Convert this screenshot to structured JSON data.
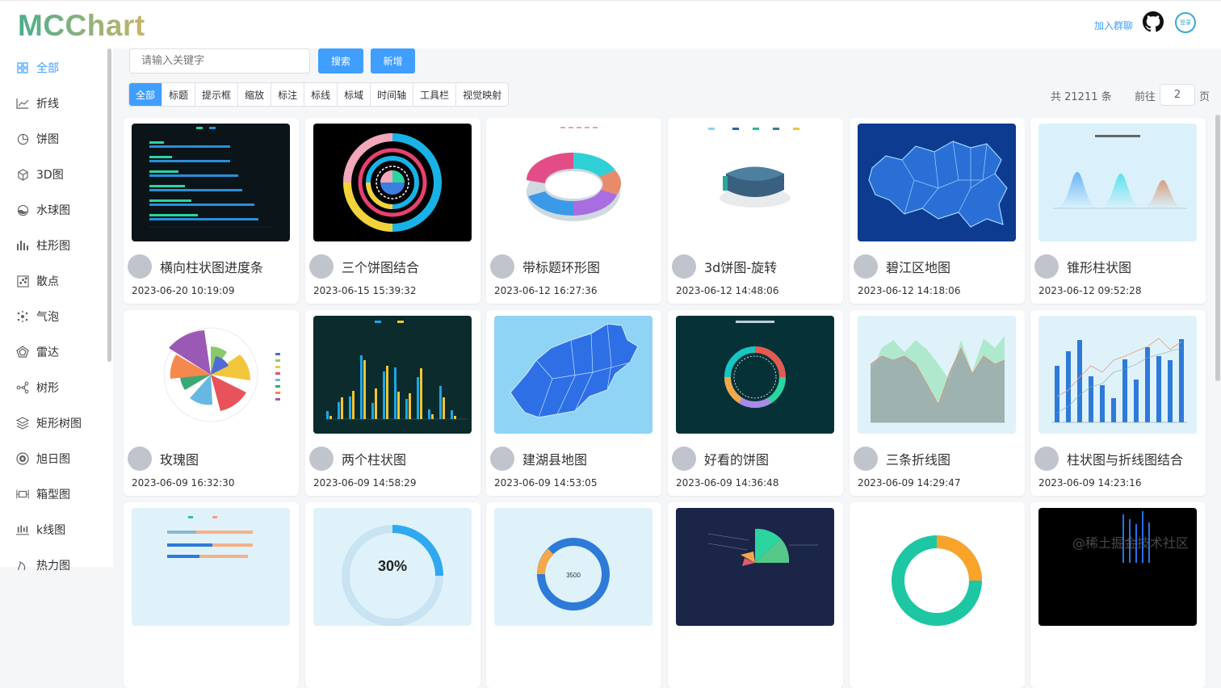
{
  "app": {
    "logo": "MCChart",
    "join_group": "加入群聊",
    "user_avatar_text": "登录"
  },
  "sidebar": {
    "items": [
      {
        "label": "全部",
        "icon": "grid-icon",
        "active": true
      },
      {
        "label": "折线",
        "icon": "line-chart-icon"
      },
      {
        "label": "饼图",
        "icon": "pie-chart-icon"
      },
      {
        "label": "3D图",
        "icon": "cube-icon"
      },
      {
        "label": "水球图",
        "icon": "liquid-ball-icon"
      },
      {
        "label": "柱形图",
        "icon": "bar-chart-icon"
      },
      {
        "label": "散点",
        "icon": "scatter-icon"
      },
      {
        "label": "气泡",
        "icon": "bubble-icon"
      },
      {
        "label": "雷达",
        "icon": "radar-icon"
      },
      {
        "label": "树形",
        "icon": "tree-icon"
      },
      {
        "label": "矩形树图",
        "icon": "treemap-icon"
      },
      {
        "label": "旭日图",
        "icon": "sunburst-icon"
      },
      {
        "label": "箱型图",
        "icon": "boxplot-icon"
      },
      {
        "label": "k线图",
        "icon": "candlestick-icon"
      },
      {
        "label": "热力图",
        "icon": "heatmap-icon"
      }
    ]
  },
  "search": {
    "placeholder": "请输入关键字",
    "search_label": "搜索",
    "add_label": "新增"
  },
  "filters": [
    "全部",
    "标题",
    "提示框",
    "缩放",
    "标注",
    "标线",
    "标域",
    "时间轴",
    "工具栏",
    "视觉映射"
  ],
  "pagination": {
    "total_text": "共 21211 条",
    "goto_prefix": "前往",
    "page": "2",
    "goto_suffix": "页"
  },
  "cards": [
    {
      "title": "横向柱状图进度条",
      "date": "2023-06-20 10:19:09",
      "thumb": "hbar-progress"
    },
    {
      "title": "三个饼图结合",
      "date": "2023-06-15 15:39:32",
      "thumb": "triple-pie"
    },
    {
      "title": "带标题环形图",
      "date": "2023-06-12 16:27:36",
      "thumb": "ring-3d"
    },
    {
      "title": "3d饼图-旋转",
      "date": "2023-06-12 14:48:06",
      "thumb": "pie-3d-rotate"
    },
    {
      "title": "碧江区地图",
      "date": "2023-06-12 14:18:06",
      "thumb": "map-blue"
    },
    {
      "title": "锥形柱状图",
      "date": "2023-06-12 09:52:28",
      "thumb": "cone-bar"
    },
    {
      "title": "玫瑰图",
      "date": "2023-06-09 16:32:30",
      "thumb": "rose"
    },
    {
      "title": "两个柱状图",
      "date": "2023-06-09 14:58:29",
      "thumb": "double-bar"
    },
    {
      "title": "建湖县地图",
      "date": "2023-06-09 14:53:05",
      "thumb": "map-light"
    },
    {
      "title": "好看的饼图",
      "date": "2023-06-09 14:36:48",
      "thumb": "nice-pie"
    },
    {
      "title": "三条折线图",
      "date": "2023-06-09 14:29:47",
      "thumb": "three-lines"
    },
    {
      "title": "柱状图与折线图结合",
      "date": "2023-06-09 14:23:16",
      "thumb": "bar-line"
    },
    {
      "title": "",
      "date": "",
      "thumb": "hbar-light"
    },
    {
      "title": "",
      "date": "",
      "thumb": "gauge-30"
    },
    {
      "title": "",
      "date": "",
      "thumb": "ring-3500"
    },
    {
      "title": "",
      "date": "",
      "thumb": "dark-funnel-pie"
    },
    {
      "title": "",
      "date": "",
      "thumb": "donut-orange"
    },
    {
      "title": "",
      "date": "",
      "thumb": "dark-bars"
    }
  ],
  "thumb_text": {
    "gauge_value": "30%",
    "ring_value": "3500"
  },
  "watermark": "@稀土掘金技术社区",
  "colors": {
    "accent": "#409eff",
    "logo_start": "#4cae8c",
    "logo_end": "#c7b46b"
  }
}
